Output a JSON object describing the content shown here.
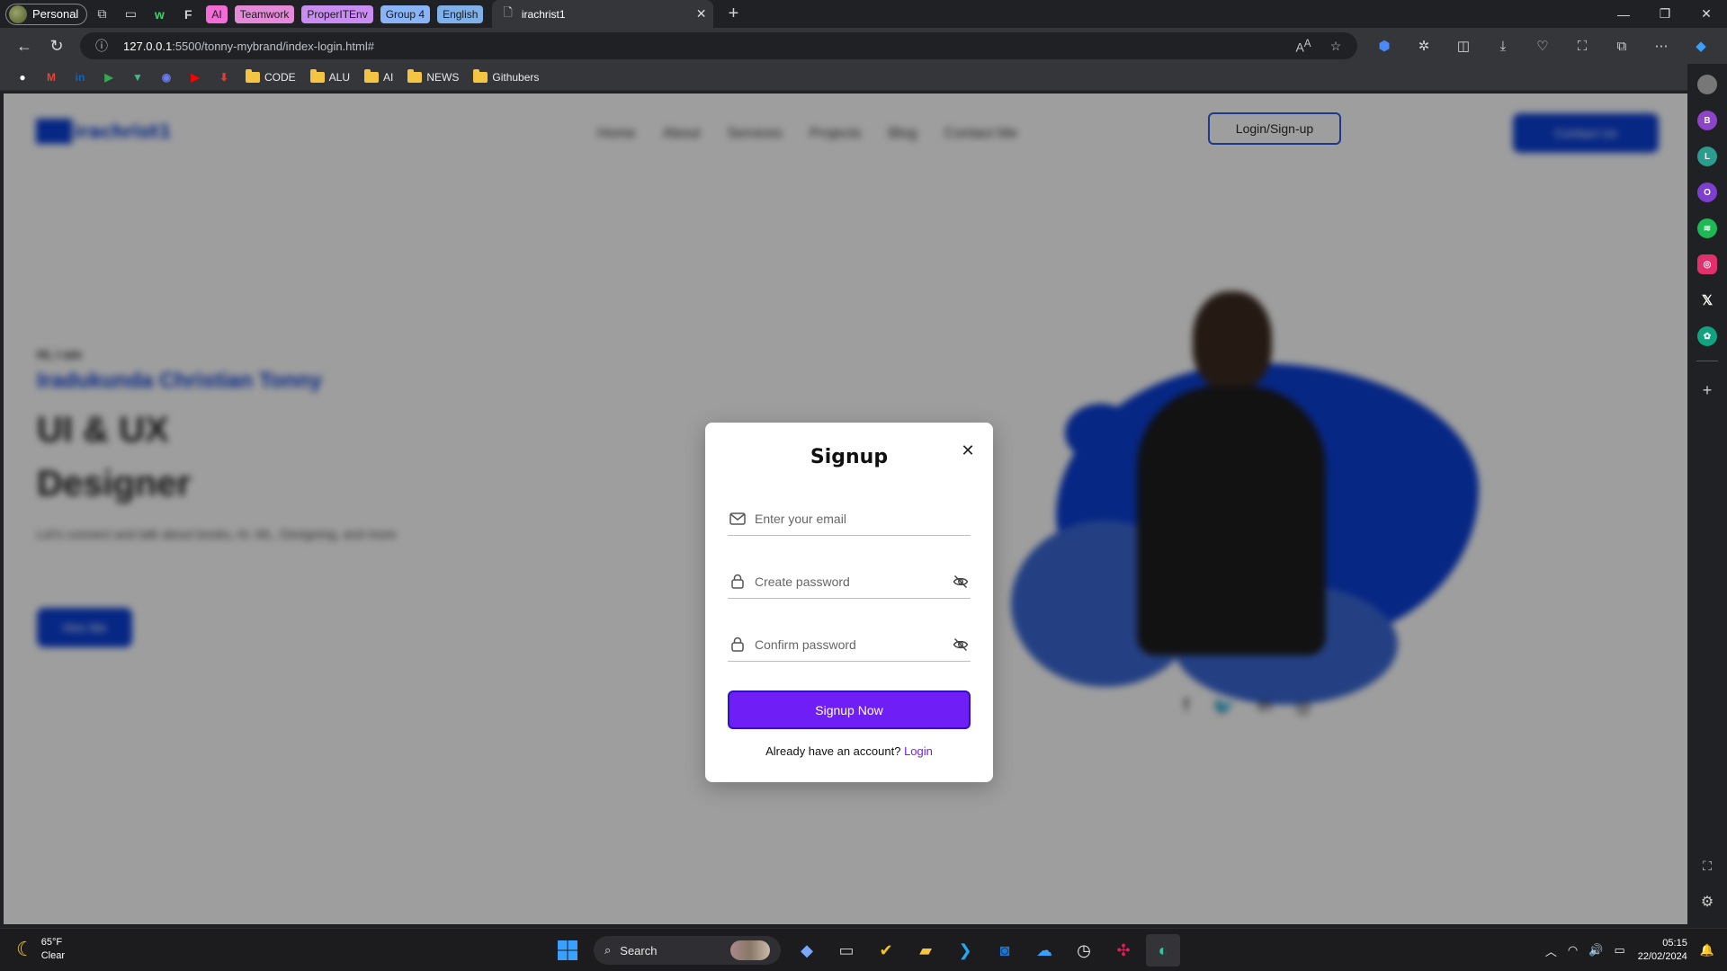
{
  "browser": {
    "profile_label": "Personal",
    "tab_groups": [
      {
        "label": "AI",
        "color": "#f36bd6"
      },
      {
        "label": "Teamwork",
        "color": "#e58ad9"
      },
      {
        "label": "ProperITEnv",
        "color": "#c98cf0"
      },
      {
        "label": "Group 4",
        "color": "#8ab4f8"
      },
      {
        "label": "English",
        "color": "#7fb0e8"
      }
    ],
    "active_tab_title": "irachrist1",
    "url_host": "127.0.0.1",
    "url_rest": ":5500/tonny-mybrand/index-login.html#",
    "bookmarks": [
      {
        "label": "CODE"
      },
      {
        "label": "ALU"
      },
      {
        "label": "AI"
      },
      {
        "label": "NEWS"
      },
      {
        "label": "Githubers"
      }
    ]
  },
  "page": {
    "logo_text": "irachrist1",
    "nav": [
      "Home",
      "About",
      "Services",
      "Projects",
      "Blog",
      "Contact Me"
    ],
    "login_button": "Login/Sign-up",
    "contact_button": "Contact Us",
    "hero": {
      "greeting": "Hi, I am",
      "name": "Iradukunda Christian Tonny",
      "role_line1": "UI & UX",
      "role_line2": "Designer",
      "description": "Let's connect and talk about books, AI, ML, Designing, and more",
      "cta": "Hire Me"
    }
  },
  "modal": {
    "title": "Signup",
    "email_placeholder": "Enter your email",
    "password_placeholder": "Create password",
    "confirm_placeholder": "Confirm password",
    "submit_label": "Signup Now",
    "alt_text": "Already have an account?",
    "alt_link": "Login",
    "accent_color": "#6f1ef5"
  },
  "sidebar": {
    "items": [
      {
        "label": "B",
        "color": "#8e44c9"
      },
      {
        "label": "L",
        "color": "#2a9d8f"
      },
      {
        "label": "O",
        "color": "#7e3fd1"
      }
    ]
  },
  "taskbar": {
    "temperature": "65°F",
    "condition": "Clear",
    "search_label": "Search",
    "time": "05:15",
    "date": "22/02/2024"
  }
}
